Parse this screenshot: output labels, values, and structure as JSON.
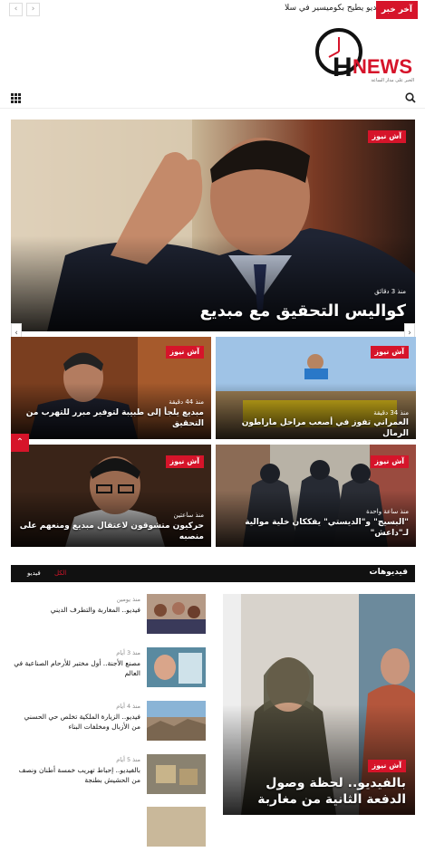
{
  "ticker": {
    "badge": "آخر خبر",
    "text": "فيديو يطيح بكوميسير في سلا",
    "prev": "‹",
    "next": "›"
  },
  "logo": {
    "letter": "H",
    "word": "NEWS",
    "tagline": "الخبر على مدار الساعة"
  },
  "colors": {
    "accent": "#d6142a",
    "dark": "#111111"
  },
  "menu": {
    "menu_icon": "grid-icon",
    "search_icon": "search-icon"
  },
  "hero": {
    "badge": "آش نيوز",
    "meta": "منذ 3 دقائق",
    "title": "كواليس التحقيق مع مبديع"
  },
  "cards": [
    {
      "badge": "آش نيوز",
      "meta": "منذ 34 دقيقة",
      "title": "العمراني تفوز في أصعب مراحل ماراطون الرمال"
    },
    {
      "badge": "آش نيوز",
      "meta": "منذ 44 دقيقة",
      "title": "مبديع يلجأ إلى طبيبة لتوفير مبرر للتهرب من التحقيق"
    },
    {
      "badge": "آش نيوز",
      "meta": "منذ ساعة واحدة",
      "title": "\"البسيج\" و\"الديستي\" يفككان خلية موالية لـ\"داعش\""
    },
    {
      "badge": "آش نيوز",
      "meta": "منذ ساعتين",
      "title": "حركيون متشوقون لاعتقال مبديع ومنعهم على منصبه"
    }
  ],
  "videos": {
    "heading": "فيديوهات",
    "tabs": [
      "الكل",
      "فيديو"
    ],
    "items": [
      {
        "date": "منذ يومين",
        "title": "فيديو.. المغاربة والتطرف الديني"
      },
      {
        "date": "منذ 3 أيام",
        "title": "مصنع الأجنة.. أول مختبر للأرحام الصناعية في العالم"
      },
      {
        "date": "منذ 4 أيام",
        "title": "فيديو.. الزيارة الملكية تخلص حي الحسني من الأزبال ومخلفات البناء"
      },
      {
        "date": "منذ 5 أيام",
        "title": "بالفيديو.. إحباط تهريب خمسة أطنان ونصف من الحشيش بطنجة"
      }
    ],
    "feature": {
      "badge": "آش نيوز",
      "title": "بالفيديو.. لحظة وصول الدفعة الثانية من مغاربة"
    }
  }
}
